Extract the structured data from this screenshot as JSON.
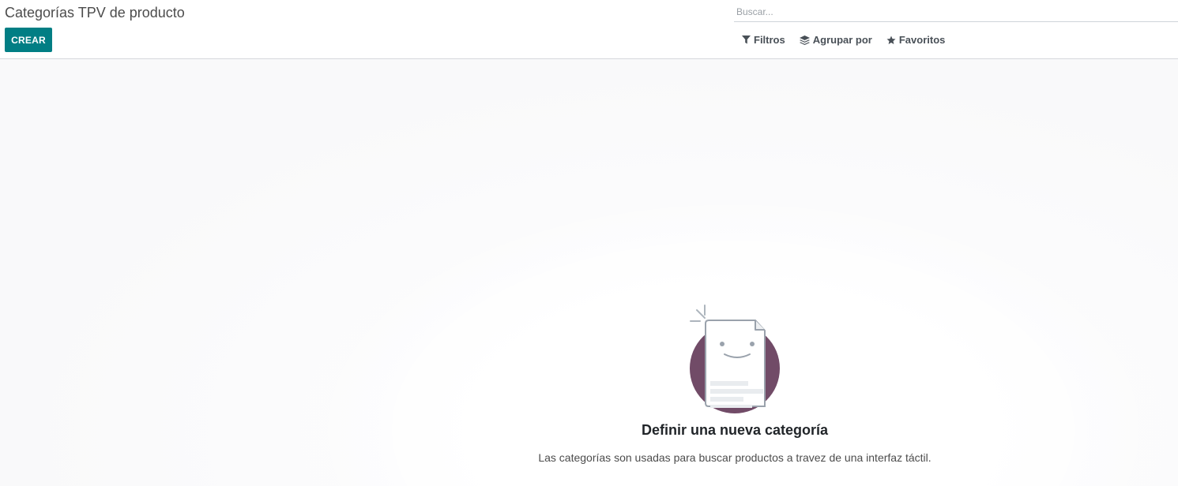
{
  "control_panel": {
    "title": "Categorías TPV de producto",
    "create_label": "CREAR",
    "search": {
      "placeholder": "Buscar..."
    },
    "options": {
      "filters_label": "Filtros",
      "group_by_label": "Agrupar por",
      "favorites_label": "Favoritos"
    }
  },
  "helper": {
    "title": "Definir una nueva categoría",
    "text": "Las categorías son usadas para buscar productos a travez de una interfaz táctil."
  },
  "colors": {
    "primary": "#017e84",
    "illustration_circle": "#714b67"
  },
  "icons": {
    "filters": "filter-icon",
    "group_by": "layers-icon",
    "favorites": "star-icon"
  }
}
